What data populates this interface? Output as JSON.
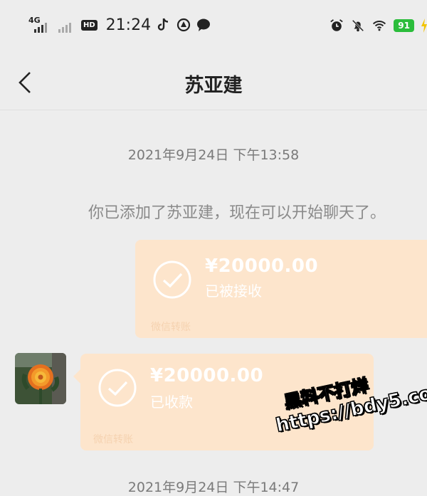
{
  "status_bar": {
    "network_label": "4G",
    "hd_label": "HD",
    "time": "21:24",
    "battery_level": "91",
    "icons": [
      "signal-icon",
      "tiktok-icon",
      "browser-icon",
      "chat-bubble-icon",
      "alarm-icon",
      "mute-icon",
      "wifi-icon",
      "battery-icon"
    ]
  },
  "nav": {
    "back_icon": "chevron-left-icon",
    "title": "苏亚建"
  },
  "messages": {
    "timestamp_1": "2021年9月24日  下午13:58",
    "system_text": "你已添加了苏亚建，现在可以开始聊天了。",
    "transfer_sent": {
      "amount": "¥20000.00",
      "status": "已被接收",
      "footer": "微信转账"
    },
    "transfer_received": {
      "amount": "¥20000.00",
      "status": "已收款",
      "footer": "微信转账"
    },
    "timestamp_2": "2021年9月24日  下午14:47"
  },
  "watermark": {
    "line1": "黑料不打烊",
    "line2": "https://bdy5.co"
  },
  "colors": {
    "background": "#ededed",
    "transfer_bg": "#fde5cc",
    "battery": "#2bbd3b"
  }
}
